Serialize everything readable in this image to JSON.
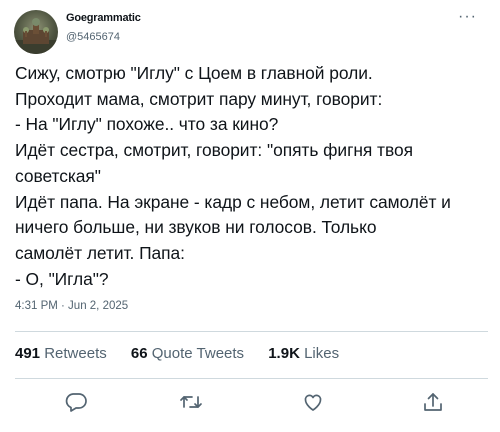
{
  "author": {
    "name": "Goegrammatic",
    "handle": "@5465674",
    "avatar_icon": "cathedral-avatar-icon"
  },
  "menu_icon": "more-options-icon",
  "tweet_text": "Сижу, смотрю \"Иглу\" с Цоем в главной роли.\nПроходит мама, смотрит пару минут, говорит:\n- На \"Иглу\" похоже.. что за кино?\nИдёт сестра, смотрит, говорит: \"опять фигня твоя\nсоветская\"\nИдёт папа. На экране - кадр с небом, летит самолёт и\nничего больше, ни звуков ни голосов. Только\nсамолёт летит. Папа:\n- О, \"Игла\"?",
  "timestamp": "4:31 PM · Jun 2, 2025",
  "stats": {
    "retweets_count": "491",
    "retweets_label": "Retweets",
    "quotes_count": "66",
    "quotes_label": "Quote Tweets",
    "likes_count": "1.9K",
    "likes_label": "Likes"
  },
  "actions": [
    "reply-icon",
    "retweet-icon",
    "like-icon",
    "share-icon"
  ],
  "colors": {
    "text": "#0f1419",
    "secondary": "#536471",
    "divider": "#cfd9de"
  }
}
